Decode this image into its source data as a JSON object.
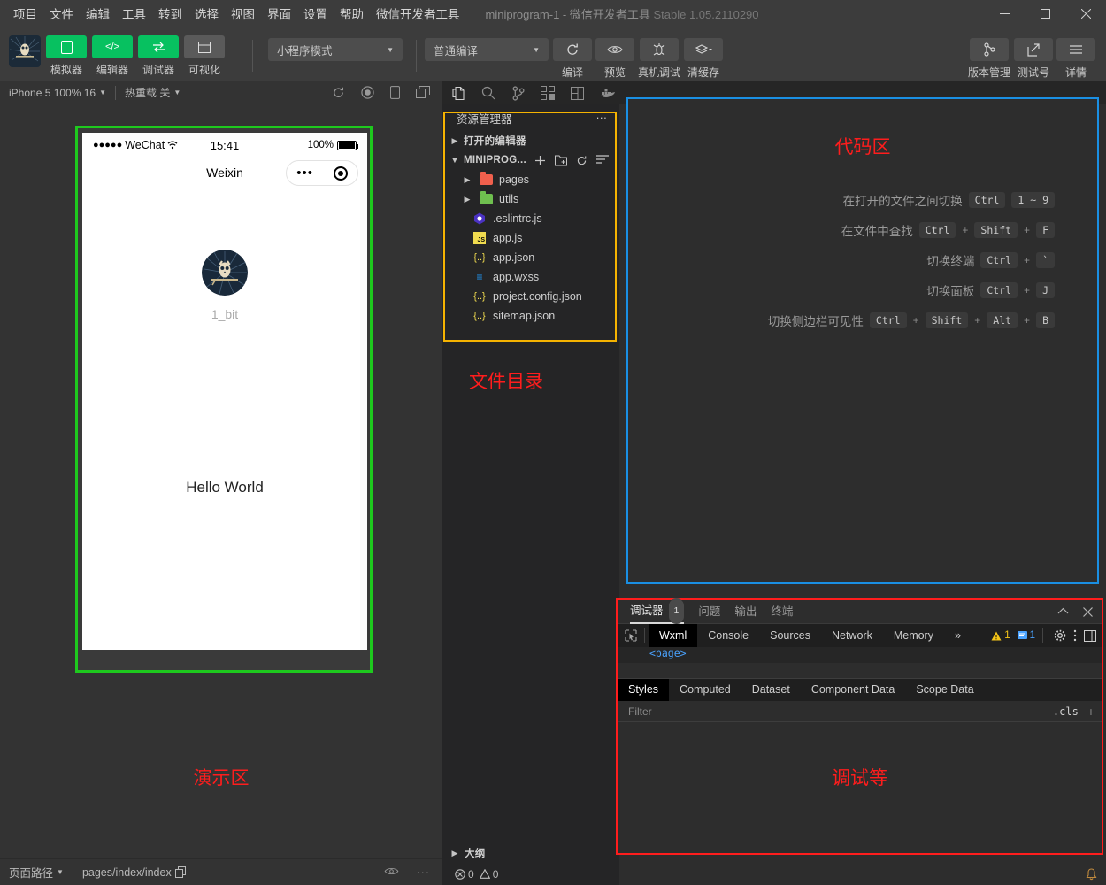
{
  "titlebar": {
    "menus": [
      "项目",
      "文件",
      "编辑",
      "工具",
      "转到",
      "选择",
      "视图",
      "界面",
      "设置",
      "帮助",
      "微信开发者工具"
    ],
    "project_title": "miniprogram-1 - 微信开发者工具",
    "version": "Stable 1.05.2110290",
    "minimize": "—",
    "maximize": "□",
    "close": "✕"
  },
  "toolbar": {
    "mode_buttons": [
      {
        "label": "模拟器",
        "icon": "phone-icon",
        "style": "green"
      },
      {
        "label": "编辑器",
        "icon": "code-icon",
        "style": "green"
      },
      {
        "label": "调试器",
        "icon": "debug-icon",
        "style": "green"
      },
      {
        "label": "可视化",
        "icon": "layout-icon",
        "style": "grey"
      }
    ],
    "mode_select": "小程序模式",
    "compile_select": "普通编译",
    "action_buttons": [
      {
        "label": "编译",
        "icon": "refresh-icon"
      },
      {
        "label": "预览",
        "icon": "eye-icon"
      },
      {
        "label": "真机调试",
        "icon": "bug-icon"
      },
      {
        "label": "清缓存",
        "icon": "layers-icon"
      }
    ],
    "right_buttons": [
      {
        "label": "版本管理",
        "icon": "branch-icon"
      },
      {
        "label": "测试号",
        "icon": "external-link-icon"
      },
      {
        "label": "详情",
        "icon": "menu-icon"
      }
    ]
  },
  "simbar": {
    "device": "iPhone 5 100% 16",
    "hot_reload": "热重载 关"
  },
  "simulator": {
    "status_bar": {
      "carrier": "WeChat",
      "dots": "●●●●●",
      "time": "15:41",
      "battery_percent": "100%"
    },
    "nav_title": "Weixin",
    "nickname": "1_bit",
    "hello_text": "Hello World",
    "caption": "演示区",
    "border_color": "#1ec91e"
  },
  "explorer": {
    "title": "资源管理器",
    "more": "···",
    "open_editors": "打开的编辑器",
    "project_name": "MINIPROG...",
    "actions": [
      "新建文件",
      "新建文件夹",
      "刷新",
      "折叠"
    ],
    "files": [
      {
        "name": "pages",
        "type": "folder",
        "color": "#f0604d",
        "expandable": true
      },
      {
        "name": "utils",
        "type": "folder",
        "color": "#6fbf4f",
        "expandable": true
      },
      {
        "name": ".eslintrc.js",
        "type": "eslint",
        "color": "#4b32c3",
        "expandable": false
      },
      {
        "name": "app.js",
        "type": "js",
        "color": "#f0db4f",
        "expandable": false
      },
      {
        "name": "app.json",
        "type": "json",
        "color": "#f0db4f",
        "expandable": false
      },
      {
        "name": "app.wxss",
        "type": "css",
        "color": "#2196f3",
        "expandable": false
      },
      {
        "name": "project.config.json",
        "type": "json",
        "color": "#f0db4f",
        "expandable": false
      },
      {
        "name": "sitemap.json",
        "type": "json",
        "color": "#f0db4f",
        "expandable": false
      }
    ],
    "caption": "文件目录",
    "outline": "大纲",
    "border_color": "#f5b301"
  },
  "code_area": {
    "caption": "代码区",
    "border_color": "#1a8fe3",
    "shortcuts": [
      {
        "label": "在打开的文件之间切换",
        "keys": [
          "Ctrl",
          "1 ~ 9"
        ],
        "separators": [
          ""
        ]
      },
      {
        "label": "在文件中查找",
        "keys": [
          "Ctrl",
          "Shift",
          "F"
        ],
        "separators": [
          "+",
          "+"
        ]
      },
      {
        "label": "切换终端",
        "keys": [
          "Ctrl",
          "`"
        ],
        "separators": [
          "+"
        ]
      },
      {
        "label": "切换面板",
        "keys": [
          "Ctrl",
          "J"
        ],
        "separators": [
          "+"
        ]
      },
      {
        "label": "切换侧边栏可见性",
        "keys": [
          "Ctrl",
          "Shift",
          "Alt",
          "B"
        ],
        "separators": [
          "+",
          "+",
          "+"
        ]
      }
    ]
  },
  "debugger": {
    "caption": "调试等",
    "border_color": "#ff1d1d",
    "panel_tabs": [
      {
        "label": "调试器",
        "badge": "1",
        "active": true
      },
      {
        "label": "问题",
        "badge": "",
        "active": false
      },
      {
        "label": "输出",
        "badge": "",
        "active": false
      },
      {
        "label": "终端",
        "badge": "",
        "active": false
      }
    ],
    "collapse_icon": "chevron-up-icon",
    "close_icon": "close-icon",
    "devtool_tabs": [
      "Wxml",
      "Console",
      "Sources",
      "Network",
      "Memory"
    ],
    "devtool_active": "Wxml",
    "overflow": "»",
    "warning_count": "1",
    "info_count": "1",
    "code_snippet": "<page>",
    "style_tabs": [
      "Styles",
      "Computed",
      "Dataset",
      "Component Data",
      "Scope Data"
    ],
    "style_active": "Styles",
    "filter_placeholder": "Filter",
    "cls_label": ".cls",
    "add_label": "+"
  },
  "statusbar": {
    "page_path_label": "页面路径",
    "page_path": "pages/index/index",
    "copy_icon": "copy-icon",
    "eye_icon": "eye-icon",
    "more_icon": "ellipsis-icon",
    "error_count": "0",
    "warning_count": "0",
    "bell_icon": "bell-icon"
  }
}
